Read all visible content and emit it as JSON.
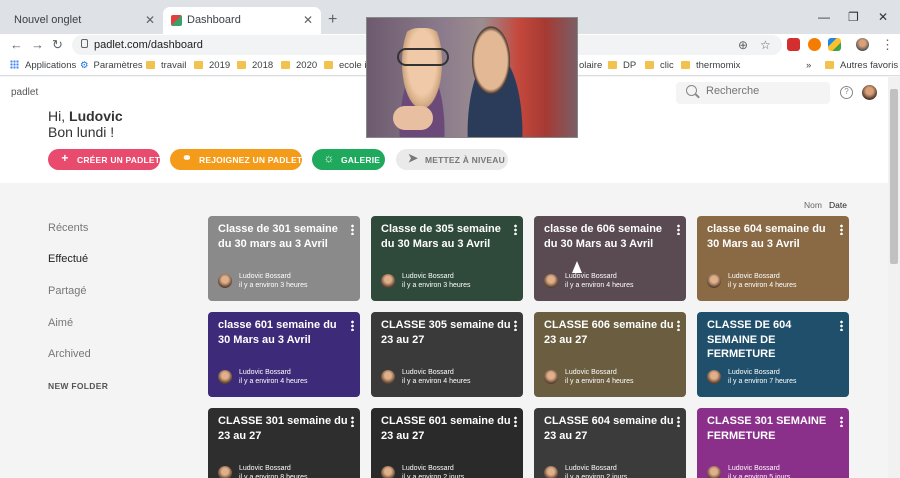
{
  "browser": {
    "tabs": [
      {
        "label": "Nouvel onglet"
      },
      {
        "label": "Dashboard"
      }
    ],
    "close_glyph": "✕",
    "newtab_glyph": "+",
    "url": "padlet.com/dashboard",
    "bookmarks": {
      "apps": "Applications",
      "settings": "Paramètres",
      "items": [
        "travail",
        "2019",
        "2018",
        "2020",
        "ecole im",
        "olaire",
        "DP",
        "clic",
        "thermomix"
      ],
      "more": "»",
      "other": "Autres favoris"
    }
  },
  "header": {
    "logo": "padlet",
    "search_placeholder": "Recherche",
    "greeting_prefix": "Hi,",
    "user_name": "Ludovic",
    "greeting_line2": "Bon lundi !",
    "buttons": {
      "create": "CRÉER UN PADLET",
      "join": "REJOIGNEZ UN PADLET",
      "gallery": "GALERIE",
      "upgrade": "METTEZ À NIVEAU"
    }
  },
  "sidebar": {
    "items": [
      "Récents",
      "Effectué",
      "Partagé",
      "Aimé",
      "Archived"
    ],
    "new_folder": "NEW FOLDER"
  },
  "sort": {
    "name": "Nom",
    "date": "Date"
  },
  "cards": [
    {
      "title": "Classe de 301 semaine du 30 mars au 3 Avril",
      "author": "Ludovic Bossard",
      "time": "il y a environ 3 heures",
      "color": "#8a8a8a"
    },
    {
      "title": "Classe de 305 semaine du 30 Mars au 3 Avril",
      "author": "Ludovic Bossard",
      "time": "il y a environ 3 heures",
      "color": "#2f4a3a"
    },
    {
      "title": "classe de 606 semaine du 30 Mars au 3 Avril",
      "author": "Ludovic Bossard",
      "time": "il y a environ 4 heures",
      "color": "#5a4a52"
    },
    {
      "title": "classe 604 semaine du 30 Mars au 3 Avril",
      "author": "Ludovic Bossard",
      "time": "il y a environ 4 heures",
      "color": "#8a6a45"
    },
    {
      "title": "classe 601 semaine du 30 Mars au 3 Avril",
      "author": "Ludovic Bossard",
      "time": "il y a environ 4 heures",
      "color": "#3d2b7a"
    },
    {
      "title": "CLASSE 305 semaine du 23 au 27",
      "author": "Ludovic Bossard",
      "time": "il y a environ 4 heures",
      "color": "#3a3a3a"
    },
    {
      "title": "CLASSE 606 semaine du 23 au 27",
      "author": "Ludovic Bossard",
      "time": "il y a environ 4 heures",
      "color": "#6b5d3f"
    },
    {
      "title": "CLASSE DE 604 SEMAINE DE FERMETURE",
      "author": "Ludovic Bossard",
      "time": "il y a environ 7 heures",
      "color": "#1f4f6b"
    },
    {
      "title": "CLASSE 301 semaine du 23 au 27",
      "author": "Ludovic Bossard",
      "time": "il y a environ 8 heures",
      "color": "#2e2e2e"
    },
    {
      "title": "CLASSE 601 semaine du 23 au 27",
      "author": "Ludovic Bossard",
      "time": "il y a environ 2 jours",
      "color": "#2a2a2a"
    },
    {
      "title": "CLASSE 604 semaine du 23 au 27",
      "author": "Ludovic Bossard",
      "time": "il y a environ 2 jours",
      "color": "#3b3b3b"
    },
    {
      "title": "CLASSE 301 SEMAINE FERMETURE",
      "author": "Ludovic Bossard",
      "time": "il y a environ 5 jours",
      "color": "#8a2f8a"
    }
  ]
}
